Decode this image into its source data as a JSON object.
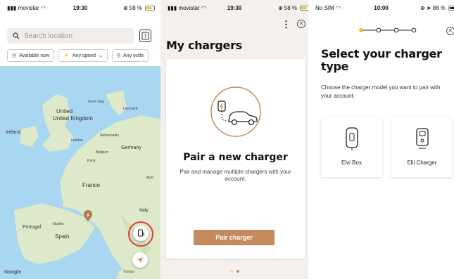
{
  "screen1": {
    "status": {
      "carrier": "movistar",
      "time": "19:30",
      "battery": "58 %"
    },
    "search": {
      "placeholder": "Search location"
    },
    "filters": [
      "Available now",
      "Any speed",
      "Any outle"
    ],
    "map": {
      "labels": {
        "north_sea": "North Sea",
        "uk": "United Kingdom",
        "ireland": "Ireland",
        "denmark": "Denmark",
        "london": "London",
        "netherlands": "Netherlands",
        "belgium": "Belgium",
        "germany": "Germany",
        "paris": "Paris",
        "france": "France",
        "austria": "Aust",
        "italy": "Italy",
        "portugal": "Portugal",
        "madrid": "Madrid",
        "spain": "Spain",
        "tunisia": "Tunisia",
        "google": "Google"
      }
    }
  },
  "screen2": {
    "status": {
      "carrier": "movistar",
      "time": "19:30",
      "battery": "58 %"
    },
    "title": "My chargers",
    "card": {
      "heading": "Pair a new charger",
      "description": "Pair and manage multiple chargers with your account.",
      "button": "Pair charger"
    }
  },
  "screen3": {
    "status": {
      "carrier": "No SIM",
      "time": "10:00",
      "battery": "88 %"
    },
    "title": "Select your charger type",
    "description": "Choose the charger model you want to pair with your account.",
    "options": [
      "Elvi Box",
      "Elli Charger"
    ]
  },
  "colors": {
    "accent": "#c58a5e",
    "highlight_ring": "#e03b3b",
    "map_water": "#a9d6f0",
    "map_land": "#dde9c9"
  }
}
